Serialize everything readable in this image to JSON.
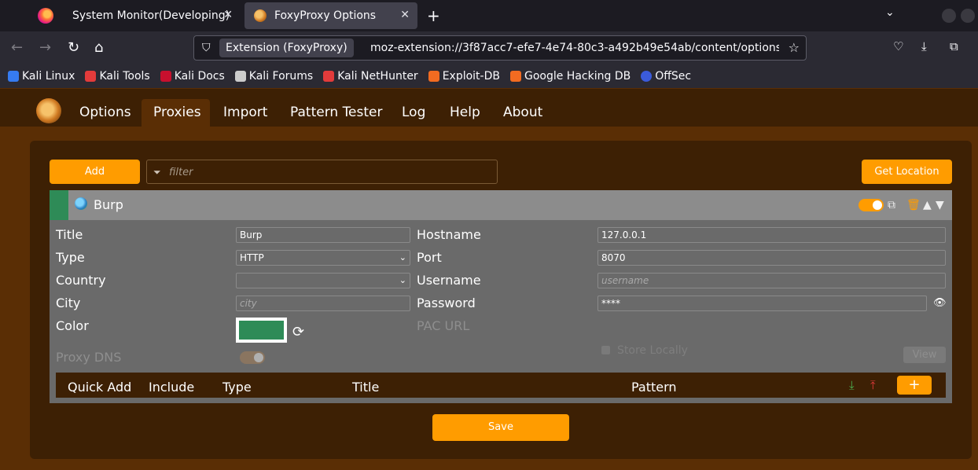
{
  "browser": {
    "tabs": [
      {
        "title": "System Monitor(Developing)",
        "close": "✕"
      },
      {
        "title": "FoxyProxy Options",
        "close": "✕"
      }
    ],
    "new_tab": "+",
    "tab_list": "⌄",
    "url_chip": "Extension (FoxyProxy)",
    "url": "moz-extension://3f87acc7-efe7-4e74-80c3-a492b49e54ab/content/options",
    "bookmarks": [
      {
        "label": "Kali Linux",
        "color": "#367bf0"
      },
      {
        "label": "Kali Tools",
        "color": "#e33b3b"
      },
      {
        "label": "Kali Docs",
        "color": "#c8102e"
      },
      {
        "label": "Kali Forums",
        "color": "#cccccc"
      },
      {
        "label": "Kali NetHunter",
        "color": "#e33b3b"
      },
      {
        "label": "Exploit-DB",
        "color": "#f26b21"
      },
      {
        "label": "Google Hacking DB",
        "color": "#f26b21"
      },
      {
        "label": "OffSec",
        "color": "#3b5bdb"
      }
    ]
  },
  "app": {
    "menu": [
      "Options",
      "Proxies",
      "Import",
      "Pattern Tester",
      "Log",
      "Help",
      "About"
    ],
    "active_menu": "Proxies",
    "add_label": "Add",
    "filter_placeholder": "filter",
    "get_location_label": "Get Location",
    "save_label": "Save"
  },
  "proxy": {
    "name": "Burp",
    "enabled": true,
    "labels": {
      "title": "Title",
      "type": "Type",
      "country": "Country",
      "city": "City",
      "color": "Color",
      "proxy_dns": "Proxy DNS",
      "hostname": "Hostname",
      "port": "Port",
      "username": "Username",
      "password": "Password",
      "pac_url": "PAC URL",
      "store_locally": "Store Locally",
      "view": "View"
    },
    "values": {
      "title": "Burp",
      "type": "HTTP",
      "country": "",
      "city_placeholder": "city",
      "hostname": "127.0.0.1",
      "port": "8070",
      "username_placeholder": "username",
      "password": "****",
      "color": "#2e8b57"
    }
  },
  "patterns": {
    "columns": [
      "Quick Add",
      "Include",
      "Type",
      "Title",
      "Pattern"
    ],
    "add_label": "+"
  }
}
